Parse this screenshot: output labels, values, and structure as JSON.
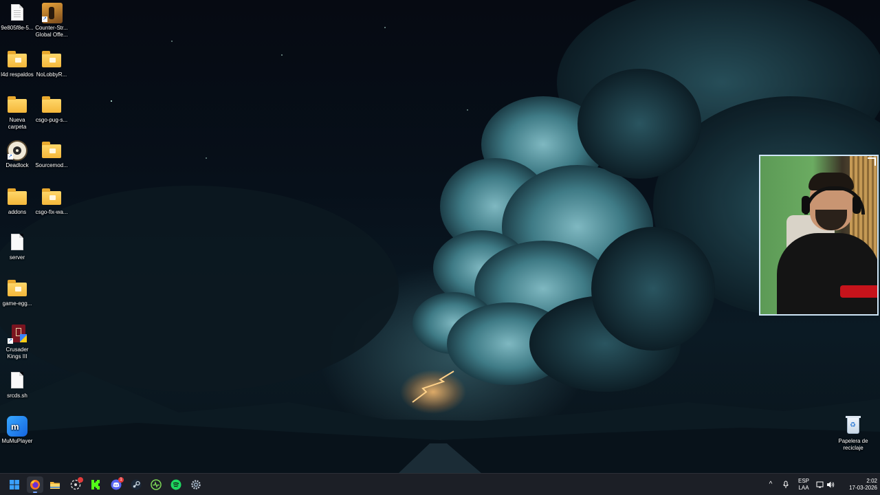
{
  "desktop": {
    "icons": [
      {
        "label": "9e805f8e-5...",
        "type": "file"
      },
      {
        "label": "Counter-Str... Global Offe...",
        "type": "app"
      },
      {
        "label": "l4d respaldos",
        "type": "folder"
      },
      {
        "label": "NoLobbyR...",
        "type": "folder"
      },
      {
        "label": "Nueva carpeta",
        "type": "folder"
      },
      {
        "label": "csgo-pug-s...",
        "type": "folder"
      },
      {
        "label": "Deadlock",
        "type": "app"
      },
      {
        "label": "Sourcemod...",
        "type": "folder"
      },
      {
        "label": "addons",
        "type": "folder"
      },
      {
        "label": "csgo-fix-wa...",
        "type": "folder"
      },
      {
        "label": "server",
        "type": "file"
      },
      {
        "label": "game-egg...",
        "type": "folder"
      },
      {
        "label": "Crusader Kings III",
        "type": "app"
      },
      {
        "label": "srcds.sh",
        "type": "file"
      },
      {
        "label": "MuMuPlayer",
        "type": "app"
      },
      {
        "label": "Papelera de reciclaje",
        "type": "recycle-bin"
      }
    ]
  },
  "taskbar": {
    "apps": [
      {
        "name": "start-button",
        "icon": "windows-icon"
      },
      {
        "name": "firefox",
        "icon": "firefox-icon",
        "active": true
      },
      {
        "name": "file-explorer",
        "icon": "folder-icon"
      },
      {
        "name": "obs",
        "icon": "record-icon",
        "badge": ""
      },
      {
        "name": "kick",
        "icon": "kick-icon"
      },
      {
        "name": "discord",
        "icon": "discord-icon",
        "badge": "1"
      },
      {
        "name": "steam",
        "icon": "steam-icon"
      },
      {
        "name": "activity-monitor",
        "icon": "pulse-icon"
      },
      {
        "name": "spotify",
        "icon": "spotify-icon"
      },
      {
        "name": "settings",
        "icon": "gear-icon"
      }
    ],
    "tray": {
      "language_line1": "ESP",
      "language_line2": "LAA",
      "time": "2:02",
      "date": "17-03-2026"
    }
  },
  "colors": {
    "taskbar_bg": "#1c1f26",
    "folder": "#f4b73a",
    "accent": "#7aa8ff"
  }
}
